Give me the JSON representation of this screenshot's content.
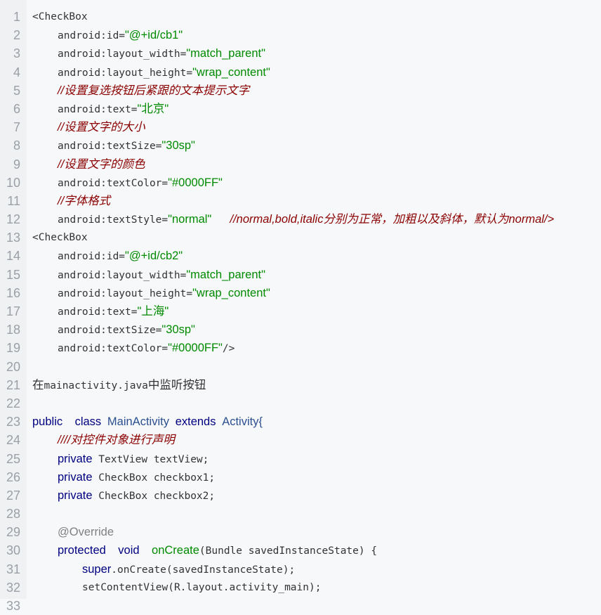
{
  "colors": {
    "background": "#f6f8fa",
    "gutter": "#eff1f3",
    "string": "#008a00",
    "comment": "#8b0000",
    "keyword": "#000080",
    "annotation": "#808080"
  },
  "lines": [
    {
      "n": "1",
      "indent": 0,
      "tokens": [
        {
          "t": "<CheckBox",
          "c": "plain"
        }
      ]
    },
    {
      "n": "2",
      "indent": 1,
      "tokens": [
        {
          "t": "android:id=",
          "c": "plain"
        },
        {
          "t": "\"@+id/cb1\"",
          "c": "str"
        }
      ]
    },
    {
      "n": "3",
      "indent": 1,
      "tokens": [
        {
          "t": "android:layout_width=",
          "c": "plain"
        },
        {
          "t": "\"match_parent\"",
          "c": "str"
        }
      ]
    },
    {
      "n": "4",
      "indent": 1,
      "tokens": [
        {
          "t": "android:layout_height=",
          "c": "plain"
        },
        {
          "t": "\"wrap_content\"",
          "c": "str"
        }
      ]
    },
    {
      "n": "5",
      "indent": 1,
      "tokens": [
        {
          "t": "//设置复选按钮后紧跟的文本提示文字",
          "c": "cmt"
        }
      ]
    },
    {
      "n": "6",
      "indent": 1,
      "tokens": [
        {
          "t": "android:text=",
          "c": "plain"
        },
        {
          "t": "\"北京\"",
          "c": "str"
        }
      ]
    },
    {
      "n": "7",
      "indent": 1,
      "tokens": [
        {
          "t": "//设置文字的大小",
          "c": "cmt"
        }
      ]
    },
    {
      "n": "8",
      "indent": 1,
      "tokens": [
        {
          "t": "android:textSize=",
          "c": "plain"
        },
        {
          "t": "\"30sp\"",
          "c": "str"
        }
      ]
    },
    {
      "n": "9",
      "indent": 1,
      "tokens": [
        {
          "t": "//设置文字的颜色",
          "c": "cmt"
        }
      ]
    },
    {
      "n": "10",
      "indent": 1,
      "tokens": [
        {
          "t": "android:textColor=",
          "c": "plain"
        },
        {
          "t": "\"#0000FF\"",
          "c": "str"
        }
      ]
    },
    {
      "n": "11",
      "indent": 1,
      "tokens": [
        {
          "t": "//字体格式",
          "c": "cmt"
        }
      ]
    },
    {
      "n": "12",
      "indent": 1,
      "tokens": [
        {
          "t": "android:textStyle=",
          "c": "plain"
        },
        {
          "t": "\"normal\"",
          "c": "str"
        },
        {
          "t": "   ",
          "c": "plain"
        },
        {
          "t": "//normal,bold,italic分别为正常，加粗以及斜体，默认为normal/>",
          "c": "cmt"
        }
      ]
    },
    {
      "n": "13",
      "indent": 0,
      "tokens": [
        {
          "t": "<CheckBox",
          "c": "plain"
        }
      ]
    },
    {
      "n": "14",
      "indent": 1,
      "tokens": [
        {
          "t": "android:id=",
          "c": "plain"
        },
        {
          "t": "\"@+id/cb2\"",
          "c": "str"
        }
      ]
    },
    {
      "n": "15",
      "indent": 1,
      "tokens": [
        {
          "t": "android:layout_width=",
          "c": "plain"
        },
        {
          "t": "\"match_parent\"",
          "c": "str"
        }
      ]
    },
    {
      "n": "16",
      "indent": 1,
      "tokens": [
        {
          "t": "android:layout_height=",
          "c": "plain"
        },
        {
          "t": "\"wrap_content\"",
          "c": "str"
        }
      ]
    },
    {
      "n": "17",
      "indent": 1,
      "tokens": [
        {
          "t": "android:text=",
          "c": "plain"
        },
        {
          "t": "\"上海\"",
          "c": "str"
        }
      ]
    },
    {
      "n": "18",
      "indent": 1,
      "tokens": [
        {
          "t": "android:textSize=",
          "c": "plain"
        },
        {
          "t": "\"30sp\"",
          "c": "str"
        }
      ]
    },
    {
      "n": "19",
      "indent": 1,
      "tokens": [
        {
          "t": "android:textColor=",
          "c": "plain"
        },
        {
          "t": "\"#0000FF\"",
          "c": "str"
        },
        {
          "t": "/>",
          "c": "plain"
        }
      ]
    },
    {
      "n": "20",
      "indent": 0,
      "tokens": []
    },
    {
      "n": "21",
      "indent": 0,
      "tokens": [
        {
          "t": "在",
          "c": "txt"
        },
        {
          "t": "mainactivity.java",
          "c": "plain"
        },
        {
          "t": "中监听按钮",
          "c": "txt"
        }
      ]
    },
    {
      "n": "22",
      "indent": 0,
      "tokens": []
    },
    {
      "n": "23",
      "indent": 0,
      "tokens": [
        {
          "t": "public",
          "c": "kw"
        },
        {
          "t": "  ",
          "c": "plain"
        },
        {
          "t": "class",
          "c": "kw"
        },
        {
          "t": " ",
          "c": "plain"
        },
        {
          "t": "MainActivity",
          "c": "cls"
        },
        {
          "t": " ",
          "c": "plain"
        },
        {
          "t": "extends",
          "c": "kw"
        },
        {
          "t": " ",
          "c": "plain"
        },
        {
          "t": "Activity{",
          "c": "cls"
        }
      ]
    },
    {
      "n": "24",
      "indent": 1,
      "tokens": [
        {
          "t": "////对控件对象进行声明",
          "c": "cmt"
        }
      ]
    },
    {
      "n": "25",
      "indent": 1,
      "tokens": [
        {
          "t": "private",
          "c": "kw"
        },
        {
          "t": " TextView textView;",
          "c": "plain"
        }
      ]
    },
    {
      "n": "26",
      "indent": 1,
      "tokens": [
        {
          "t": "private",
          "c": "kw"
        },
        {
          "t": " CheckBox checkbox1;",
          "c": "plain"
        }
      ]
    },
    {
      "n": "27",
      "indent": 1,
      "tokens": [
        {
          "t": "private",
          "c": "kw"
        },
        {
          "t": " CheckBox checkbox2;",
          "c": "plain"
        }
      ]
    },
    {
      "n": "28",
      "indent": 0,
      "tokens": []
    },
    {
      "n": "29",
      "indent": 1,
      "tokens": [
        {
          "t": "@Override",
          "c": "ann"
        }
      ]
    },
    {
      "n": "30",
      "indent": 1,
      "tokens": [
        {
          "t": "protected",
          "c": "kw"
        },
        {
          "t": "  ",
          "c": "plain"
        },
        {
          "t": "void",
          "c": "kw"
        },
        {
          "t": "  ",
          "c": "plain"
        },
        {
          "t": "onCreate",
          "c": "fn"
        },
        {
          "t": "(Bundle savedInstanceState) {",
          "c": "plain"
        }
      ]
    },
    {
      "n": "31",
      "indent": 2,
      "tokens": [
        {
          "t": "super",
          "c": "kw"
        },
        {
          "t": ".onCreate(savedInstanceState);",
          "c": "plain"
        }
      ]
    },
    {
      "n": "32",
      "indent": 2,
      "tokens": [
        {
          "t": "setContentView(R.layout.activity_main);",
          "c": "plain"
        }
      ]
    },
    {
      "n": "33",
      "indent": 0,
      "tokens": []
    }
  ]
}
